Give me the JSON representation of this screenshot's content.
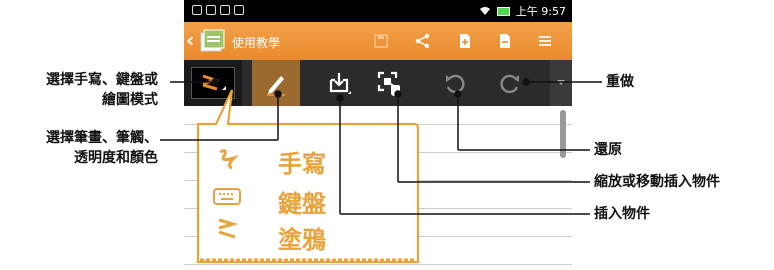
{
  "status_bar": {
    "time": "上午 9:57"
  },
  "app_bar": {
    "title": "使用教學",
    "accent": "#e98a2c"
  },
  "toolbar": {
    "buttons": [
      "mode",
      "pen",
      "insert",
      "move",
      "undo",
      "redo"
    ],
    "icons": [
      "mode-icon",
      "pen-icon",
      "insert-object-icon",
      "move-object-icon",
      "undo-icon",
      "redo-icon"
    ]
  },
  "note": {
    "line1": "手寫",
    "line2": "鍵盤",
    "line3": "塗鴉"
  },
  "callouts": {
    "mode_line1": "選擇手寫、鍵盤或",
    "mode_line2": "繪圖模式",
    "pen_line1": "選擇筆畫、筆觸、",
    "pen_line2": "透明度和顏色",
    "redo": "重做",
    "undo": "還原",
    "move": "縮放或移動插入物件",
    "insert": "插入物件"
  }
}
